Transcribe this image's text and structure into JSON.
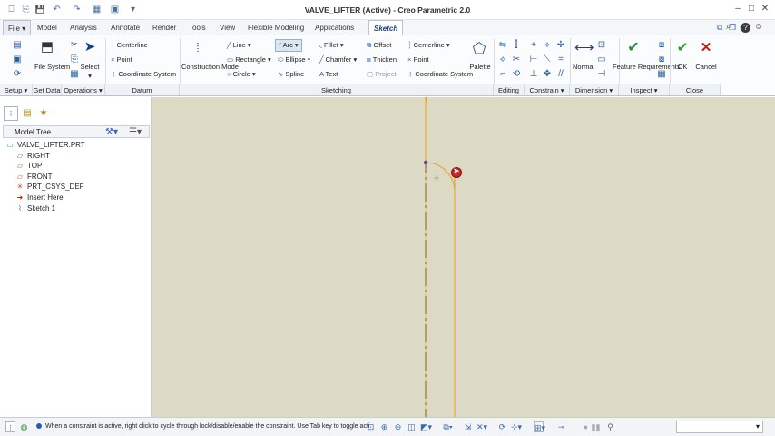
{
  "window": {
    "title": "VALVE_LIFTER (Active) - Creo Parametric 2.0",
    "controls": {
      "minimize": "–",
      "maximize": "□",
      "close": "✕"
    }
  },
  "quick_access": [
    "⎕",
    "⎘",
    "💾",
    "↶",
    "↷",
    "▦",
    "▣",
    "▾"
  ],
  "help_icons": [
    "⧉",
    "❐",
    "▫",
    "🔍",
    "?",
    "☺"
  ],
  "tabs": [
    {
      "label": "File",
      "active": false
    },
    {
      "label": "Model",
      "active": false
    },
    {
      "label": "Analysis",
      "active": false
    },
    {
      "label": "Annotate",
      "active": false
    },
    {
      "label": "Render",
      "active": false
    },
    {
      "label": "Tools",
      "active": false
    },
    {
      "label": "View",
      "active": false
    },
    {
      "label": "Flexible Modeling",
      "active": false
    },
    {
      "label": "Applications",
      "active": false
    },
    {
      "label": "Sketch",
      "active": true
    }
  ],
  "ribbon": {
    "setup": {
      "file_system": "File System",
      "group": "Setup"
    },
    "get_data": {
      "group": "Get Data"
    },
    "operations": {
      "select": "Select",
      "group": "Operations"
    },
    "datum": {
      "centerline": "Centerline",
      "point": "Point",
      "coordinate_system": "Coordinate System",
      "group": "Datum"
    },
    "sketching": {
      "construction_mode": "Construction Mode",
      "line": "Line",
      "rectangle": "Rectangle",
      "circle": "Circle",
      "arc": "Arc",
      "ellipse": "Ellipse",
      "spline": "Spline",
      "fillet": "Fillet",
      "chamfer": "Chamfer",
      "text": "Text",
      "offset": "Offset",
      "thicken": "Thicken",
      "project": "Project",
      "centerline": "Centerline",
      "point": "Point",
      "coordinate_system": "Coordinate System",
      "palette": "Palette",
      "group": "Sketching"
    },
    "editing": {
      "group": "Editing"
    },
    "constrain": {
      "group": "Constrain"
    },
    "dimension": {
      "normal": "Normal",
      "group": "Dimension"
    },
    "inspect": {
      "feature_requirements": "Feature Requirements",
      "group": "Inspect"
    },
    "close": {
      "ok": "OK",
      "cancel": "Cancel",
      "group": "Close"
    }
  },
  "panel": {
    "tree_label": "Model Tree",
    "items": [
      {
        "label": "VALVE_LIFTER.PRT",
        "icon": "part-icon",
        "glyph": "▭",
        "color": "#3a78c0"
      },
      {
        "label": "RIGHT",
        "icon": "datum-plane-icon",
        "glyph": "▱",
        "color": "#b05a2a"
      },
      {
        "label": "TOP",
        "icon": "datum-plane-icon",
        "glyph": "▱",
        "color": "#b05a2a"
      },
      {
        "label": "FRONT",
        "icon": "datum-plane-icon",
        "glyph": "▱",
        "color": "#b05a2a"
      },
      {
        "label": "PRT_CSYS_DEF",
        "icon": "csys-icon",
        "glyph": "✳",
        "color": "#b04a2a"
      },
      {
        "label": "Insert Here",
        "icon": "insert-arrow-icon",
        "glyph": "➜",
        "color": "#c0201a"
      },
      {
        "label": "Sketch 1",
        "icon": "sketch-icon",
        "glyph": "⌇",
        "color": "#3a78c0"
      }
    ]
  },
  "status": {
    "message": "When a constraint is active, right click to cycle through lock/disable/enable the constraint. Use Tab key to toggle acti"
  },
  "colors": {
    "canvas_bg": "#dcd9c4",
    "sketch_line": "#f0a020",
    "centerline": "#2e2e2e",
    "cursor": "#cc2a2a"
  }
}
